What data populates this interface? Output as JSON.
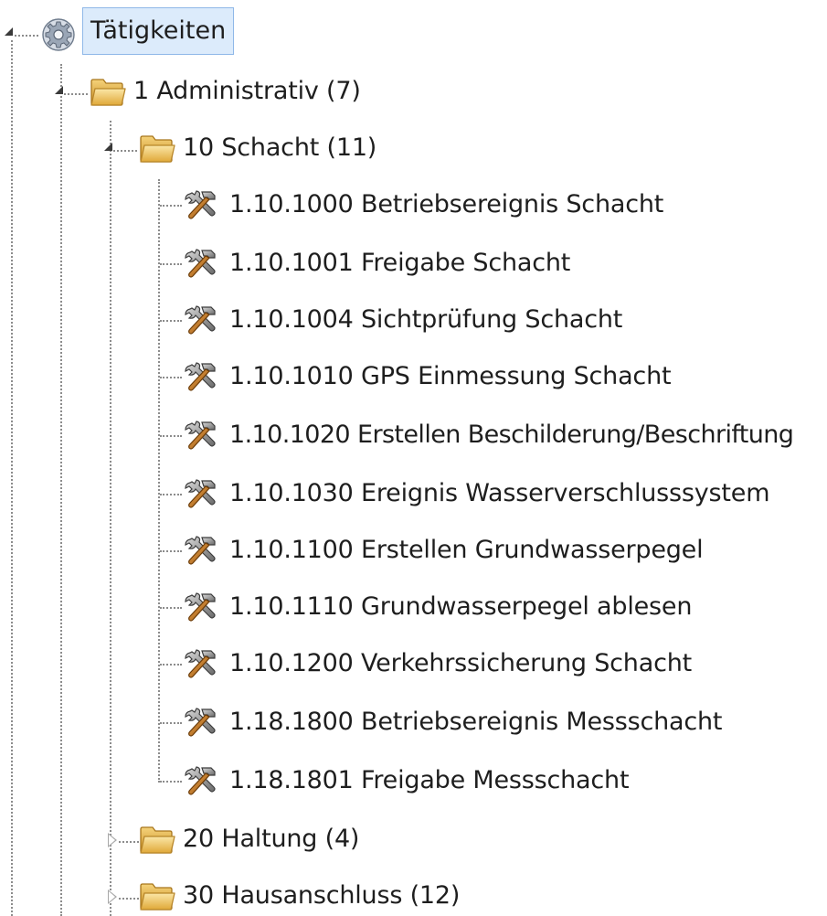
{
  "tree": {
    "root": {
      "label": "Tätigkeiten",
      "icon": "gear-icon",
      "expanded": true,
      "selected": true
    },
    "level1": {
      "label": "1 Administrativ (7)",
      "icon": "folder-icon",
      "expanded": true
    },
    "level2": [
      {
        "label": "10 Schacht (11)",
        "icon": "folder-icon",
        "expanded": true,
        "children": [
          {
            "label": "1.10.1000 Betriebsereignis Schacht",
            "icon": "tools-icon"
          },
          {
            "label": "1.10.1001 Freigabe Schacht",
            "icon": "tools-icon"
          },
          {
            "label": "1.10.1004 Sichtprüfung Schacht",
            "icon": "tools-icon"
          },
          {
            "label": "1.10.1010 GPS Einmessung Schacht",
            "icon": "tools-icon"
          },
          {
            "label": "1.10.1020 Erstellen Beschilderung/Beschriftung",
            "icon": "tools-icon"
          },
          {
            "label": "1.10.1030 Ereignis Wasserverschlusssystem",
            "icon": "tools-icon"
          },
          {
            "label": "1.10.1100 Erstellen Grundwasserpegel",
            "icon": "tools-icon"
          },
          {
            "label": "1.10.1110 Grundwasserpegel ablesen",
            "icon": "tools-icon"
          },
          {
            "label": "1.10.1200 Verkehrssicherung Schacht",
            "icon": "tools-icon"
          },
          {
            "label": "1.18.1800 Betriebsereignis Messschacht",
            "icon": "tools-icon"
          },
          {
            "label": "1.18.1801 Freigabe Messschacht",
            "icon": "tools-icon"
          }
        ]
      },
      {
        "label": "20 Haltung (4)",
        "icon": "folder-icon",
        "expanded": false
      },
      {
        "label": "30 Hausanschluss (12)",
        "icon": "folder-icon",
        "expanded": false
      }
    ]
  },
  "colors": {
    "selection_background": "#dcebfb",
    "selection_border": "#8fb8e8",
    "guide_lines": "#8c8c8c",
    "folder": "#e8b84a",
    "text": "#1e1e1e"
  }
}
